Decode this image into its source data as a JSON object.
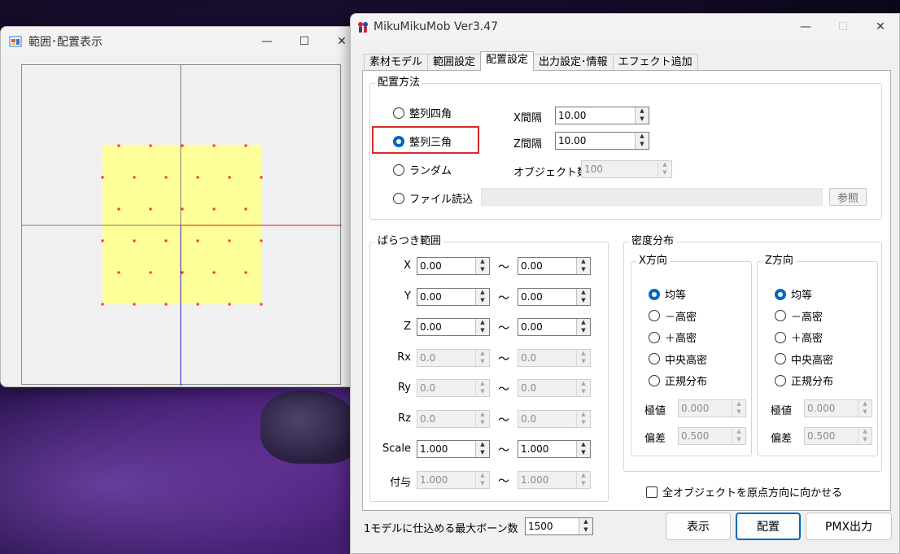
{
  "left_window": {
    "title": "範囲･配置表示",
    "controls": {
      "minimize": "—",
      "maximize": "☐",
      "close": "✕"
    }
  },
  "right_window": {
    "title": "MikuMikuMob Ver3.47",
    "controls": {
      "minimize": "—",
      "maximize": "☐",
      "close": "✕"
    },
    "tabs": [
      "素材モデル",
      "範囲設定",
      "配置設定",
      "出力設定･情報",
      "エフェクト追加"
    ],
    "active_tab": "配置設定",
    "placement": {
      "label": "配置方法",
      "options": [
        "整列四角",
        "整列三角",
        "ランダム",
        "ファイル読込"
      ],
      "selected": "整列三角",
      "x_interval_label": "X間隔",
      "x_interval": "10.00",
      "z_interval_label": "Z間隔",
      "z_interval": "10.00",
      "object_count_label": "オブジェクト数",
      "object_count": "100",
      "browse_label": "参照"
    },
    "scatter": {
      "label": "ばらつき範囲",
      "rows": [
        {
          "name": "X",
          "min": "0.00",
          "max": "0.00",
          "enabled": true
        },
        {
          "name": "Y",
          "min": "0.00",
          "max": "0.00",
          "enabled": true
        },
        {
          "name": "Z",
          "min": "0.00",
          "max": "0.00",
          "enabled": true
        },
        {
          "name": "Rx",
          "min": "0.0",
          "max": "0.0",
          "enabled": false
        },
        {
          "name": "Ry",
          "min": "0.0",
          "max": "0.0",
          "enabled": false
        },
        {
          "name": "Rz",
          "min": "0.0",
          "max": "0.0",
          "enabled": false
        },
        {
          "name": "Scale",
          "min": "1.000",
          "max": "1.000",
          "enabled": true
        },
        {
          "name": "付与",
          "min": "1.000",
          "max": "1.000",
          "enabled": false
        }
      ],
      "tilde": "～"
    },
    "density": {
      "label": "密度分布",
      "x_dir": {
        "label": "X方向",
        "options": [
          "均等",
          "－高密",
          "＋高密",
          "中央高密",
          "正規分布"
        ],
        "selected": "均等",
        "extreme_label": "極値",
        "extreme": "0.000",
        "deviation_label": "偏差",
        "deviation": "0.500"
      },
      "z_dir": {
        "label": "Z方向",
        "options": [
          "均等",
          "－高密",
          "＋高密",
          "中央高密",
          "正規分布"
        ],
        "selected": "均等",
        "extreme_label": "極値",
        "extreme": "0.000",
        "deviation_label": "偏差",
        "deviation": "0.500"
      }
    },
    "face_origin_label": "全オブジェクトを原点方向に向かせる",
    "max_bones_label": "1モデルに仕込める最大ボーン数",
    "max_bones": "1500",
    "buttons": {
      "display": "表示",
      "place": "配置",
      "pmx_output": "PMX出力"
    }
  },
  "colors": {
    "accent": "#0067c0",
    "highlight": "#d62b2b",
    "area_fill": "#ffff99",
    "dot": "#ff3030",
    "axis_x": "#e02020",
    "axis_z": "#2020d0"
  }
}
